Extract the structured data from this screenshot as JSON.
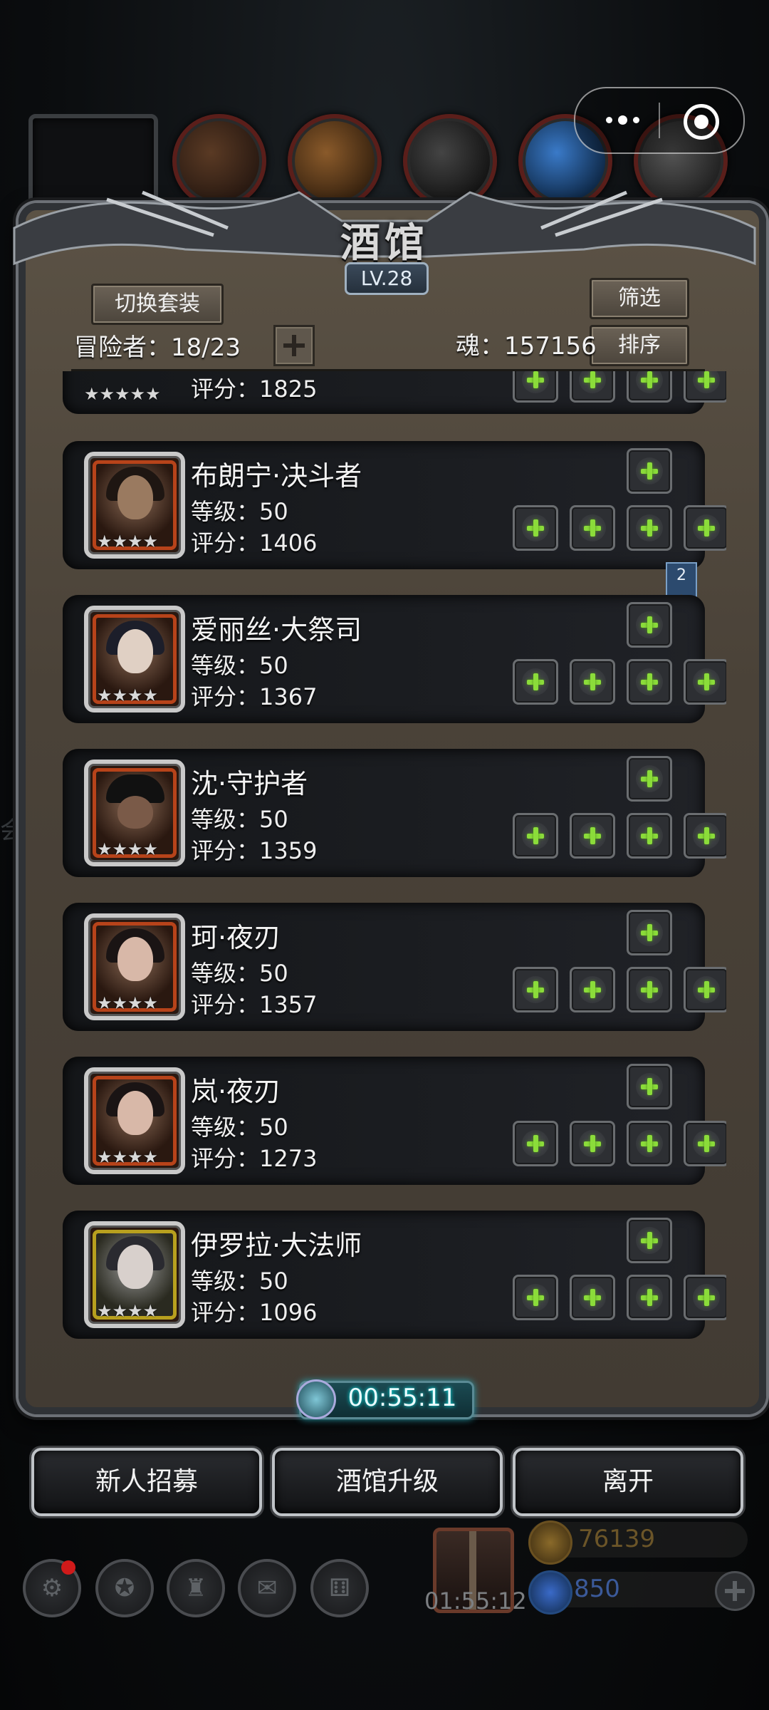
{
  "header": {
    "title": "酒馆",
    "level": "LV.28",
    "switch_set_label": "切换套装",
    "filter_label": "筛选",
    "sort_label": "排序",
    "adventurers": "冒险者：18/23",
    "soul": "魂：157156"
  },
  "partial_card": {
    "score": "评分：1825",
    "stars": "★★★★★"
  },
  "heroes": [
    {
      "name": "布朗宁·决斗者",
      "level": "等级：50",
      "score": "评分：1406",
      "stars": "★★★★"
    },
    {
      "name": "爱丽丝·大祭司",
      "level": "等级：50",
      "score": "评分：1367",
      "stars": "★★★★"
    },
    {
      "name": "沈·守护者",
      "level": "等级：50",
      "score": "评分：1359",
      "stars": "★★★★"
    },
    {
      "name": "珂·夜刃",
      "level": "等级：50",
      "score": "评分：1357",
      "stars": "★★★★"
    },
    {
      "name": "岚·夜刃",
      "level": "等级：50",
      "score": "评分：1273",
      "stars": "★★★★"
    },
    {
      "name": "伊罗拉·大法师",
      "level": "等级：50",
      "score": "评分：1096",
      "stars": "★★★★"
    }
  ],
  "bookmark_number": "2",
  "timer": "00:55:11",
  "buttons": {
    "recruit": "新人招募",
    "upgrade": "酒馆升级",
    "leave": "离开"
  },
  "hud": {
    "gift_timer": "01:55:12",
    "gold": "76139",
    "gems": "850",
    "side_char": "会"
  },
  "colors": {
    "gold_text": "#6b5528",
    "gem_text": "#3b5a9a",
    "plus_green": "#8bdc3a"
  }
}
